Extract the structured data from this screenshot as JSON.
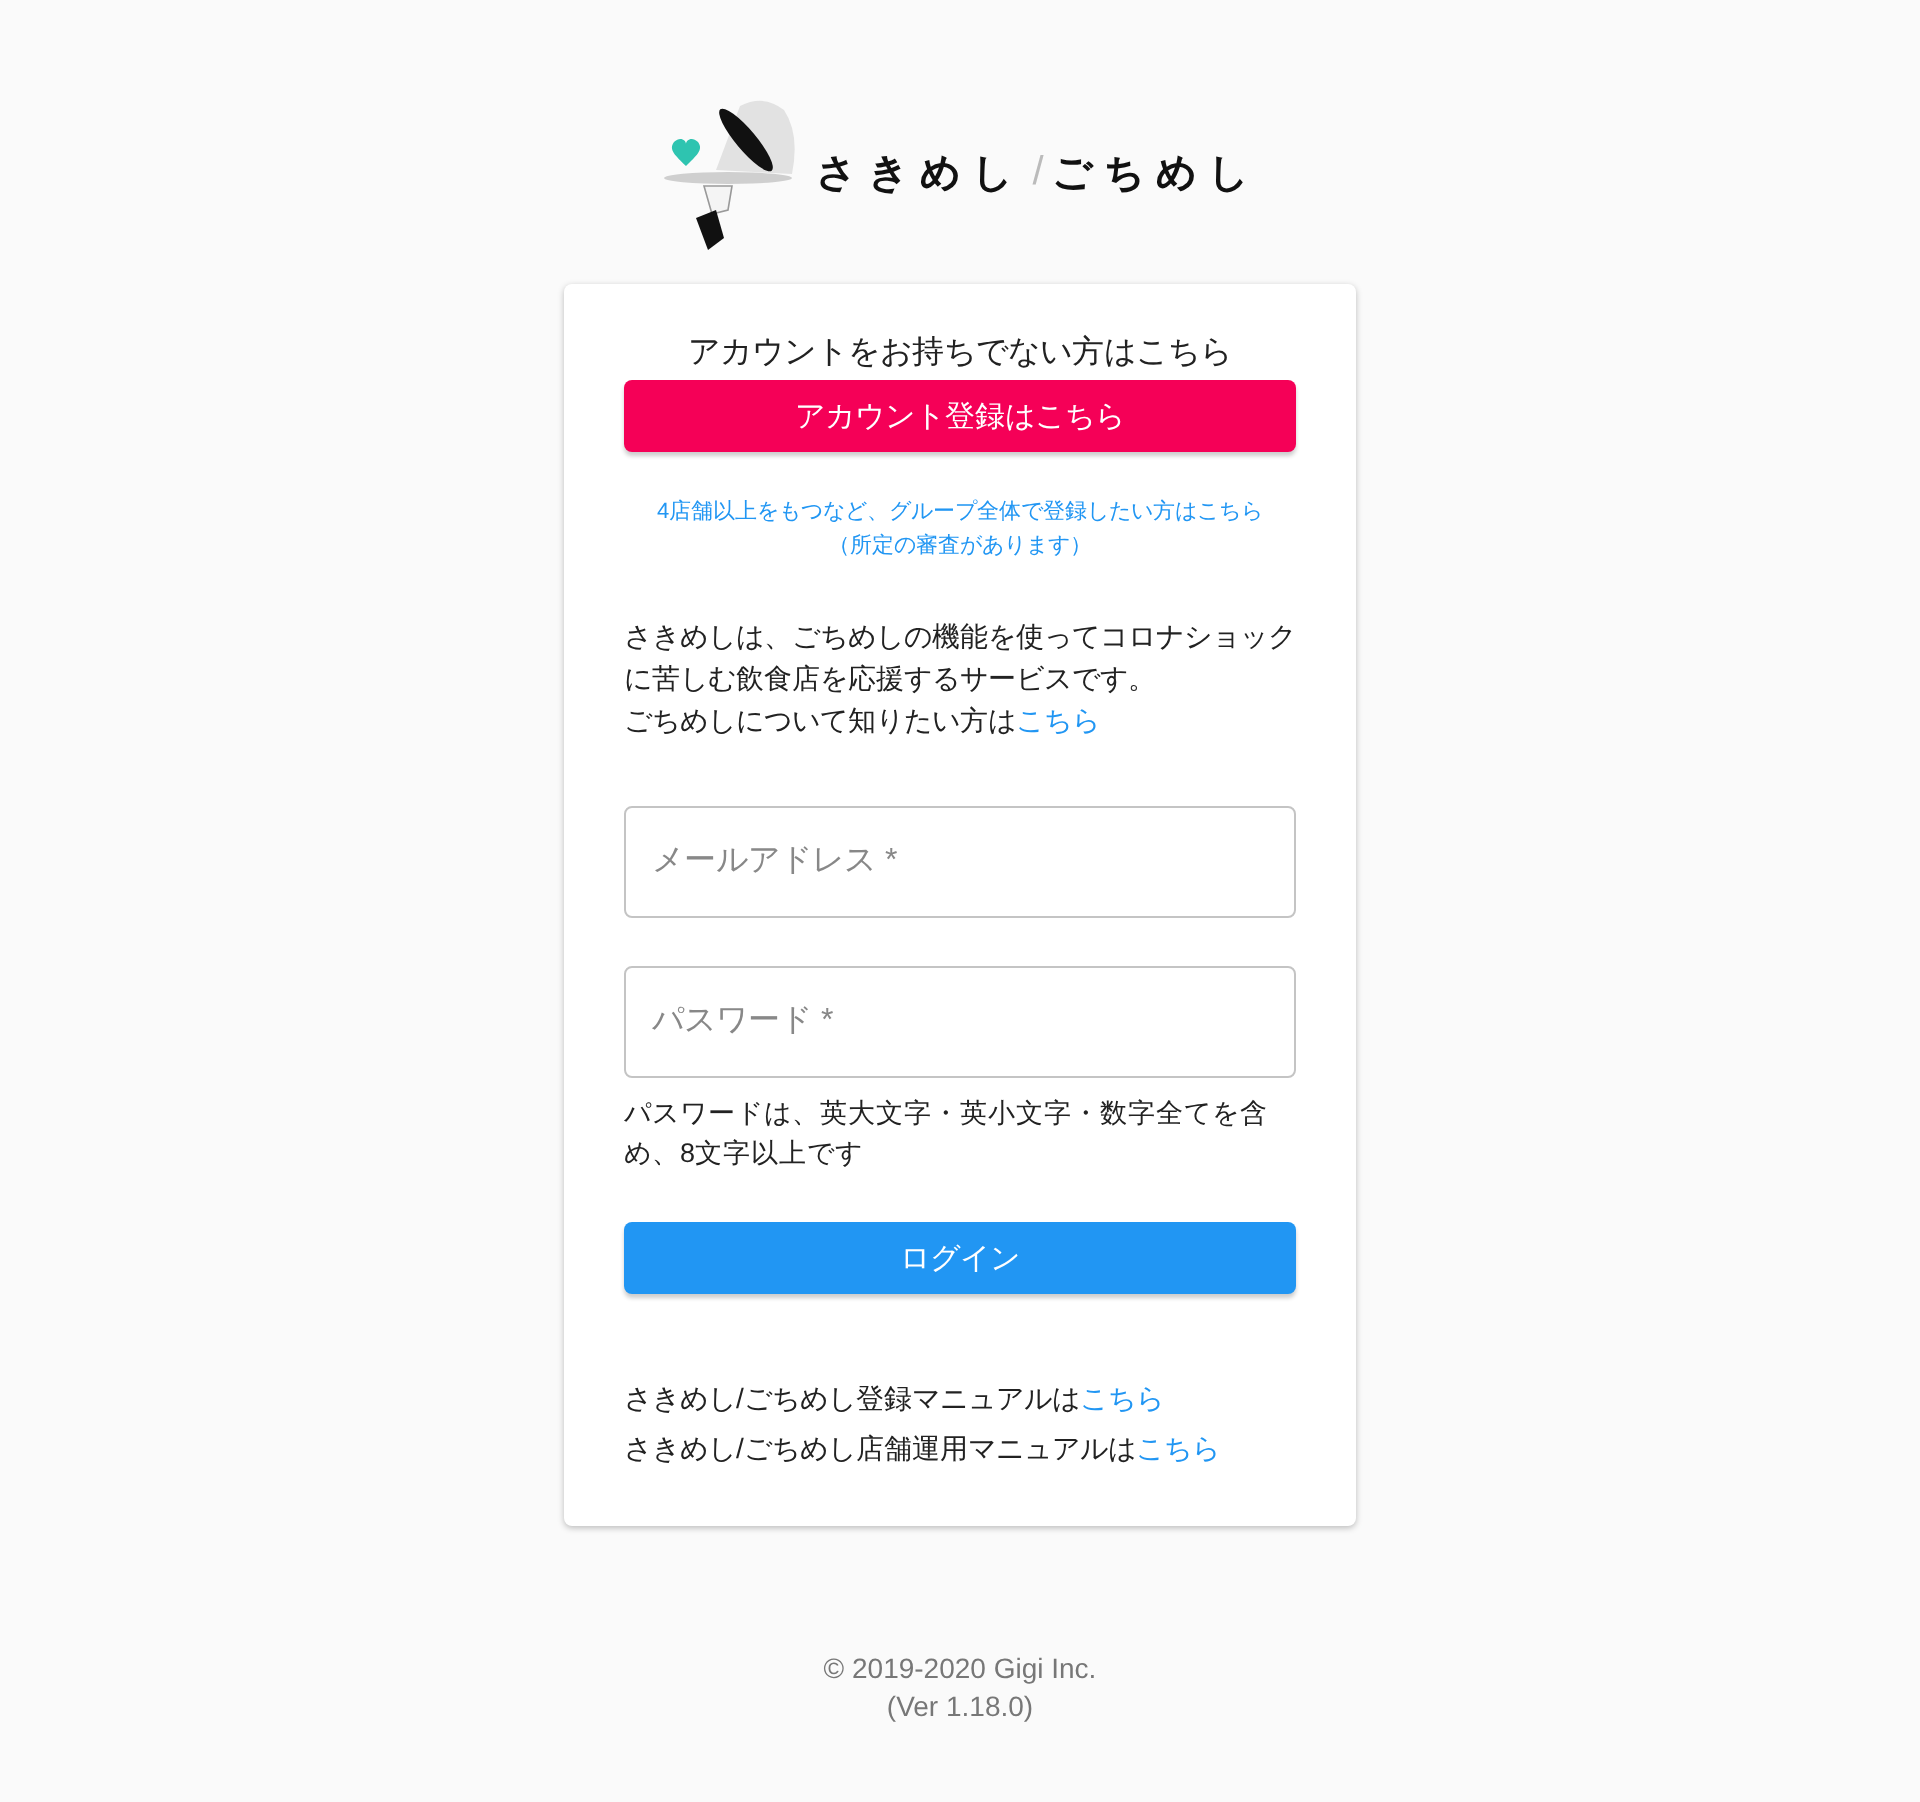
{
  "logo": {
    "left": "さきめし",
    "separator": "/",
    "right": "ごちめし"
  },
  "signup": {
    "prompt": "アカウントをお持ちでない方はこちら",
    "button": "アカウント登録はこちら"
  },
  "group_link": {
    "lines": [
      "4店舗以上をもつなど、グループ全体で登録したい方はこちら",
      "（所定の審査があります）"
    ]
  },
  "intro": {
    "text": "さきめしは、ごちめしの機能を使ってコロナショックに苦しむ飲食店を応援するサービスです。",
    "link_prefix": "ごちめしについて知りたい方は",
    "link": "こちら"
  },
  "fields": [
    {
      "placeholder": "メールアドレス *"
    },
    {
      "placeholder": "パスワード *",
      "hint": "パスワードは、英大文字・英小文字・数字全てを含め、8文字以上です"
    }
  ],
  "login_button": "ログイン",
  "manuals": [
    {
      "text": "さきめし/ごちめし登録マニュアルは",
      "link": "こちら"
    },
    {
      "text": "さきめし/ごちめし店舗運用マニュアルは",
      "link": "こちら"
    }
  ],
  "footer": [
    "© 2019-2020 Gigi Inc.",
    "(Ver 1.18.0)"
  ]
}
